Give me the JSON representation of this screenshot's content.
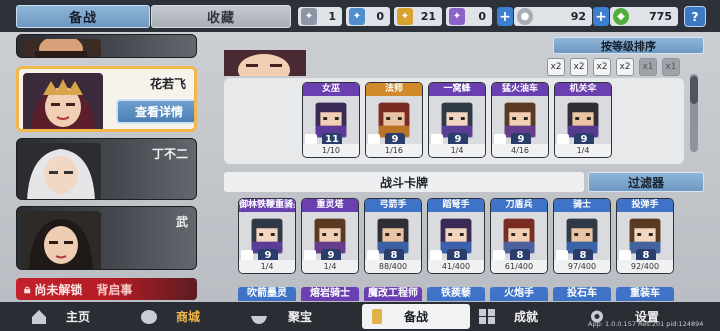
{
  "tabs": {
    "active": "备战",
    "inactive": "收藏"
  },
  "resources": [
    {
      "name": "scroll-blue",
      "value": "1",
      "color": "#8c96a6"
    },
    {
      "name": "scroll-cyan",
      "value": "0",
      "color": "#4f8fce"
    },
    {
      "name": "scroll-gold",
      "value": "21",
      "color": "#d8a22e"
    },
    {
      "name": "scroll-purple",
      "value": "0",
      "color": "#8a62c8"
    },
    {
      "name": "silver-coin",
      "value": "92",
      "color": "#a8adb5"
    },
    {
      "name": "green-gem",
      "value": "775",
      "color": "#4fae3c"
    }
  ],
  "help_label": "?",
  "plus_label": "+",
  "heroes": [
    {
      "name": "花若飞",
      "selected": true,
      "detail_label": "查看详情"
    },
    {
      "name": "丁不二",
      "selected": false
    },
    {
      "name": "武",
      "selected": false
    }
  ],
  "locked_banner": {
    "text": "尚未解锁",
    "suffix": "背启事"
  },
  "sort_label": "按等级排序",
  "filter_icons": [
    {
      "label": "x2",
      "active": true
    },
    {
      "label": "x2",
      "active": true
    },
    {
      "label": "x2",
      "active": true
    },
    {
      "label": "x2",
      "active": true
    },
    {
      "label": "x1",
      "active": false
    },
    {
      "label": "x1",
      "active": false
    }
  ],
  "deck_cards": [
    {
      "name": "女巫",
      "level": "11",
      "count": "1/10",
      "color": "#6a3fb0"
    },
    {
      "name": "法师",
      "level": "9",
      "count": "1/16",
      "color": "#d08a2a"
    },
    {
      "name": "一窝蜂",
      "level": "9",
      "count": "1/4",
      "color": "#6a3fb0"
    },
    {
      "name": "猛火油车",
      "level": "9",
      "count": "4/16",
      "color": "#6a3fb0"
    },
    {
      "name": "机关伞",
      "level": "9",
      "count": "1/4",
      "color": "#6a3fb0"
    }
  ],
  "section_title": "战斗卡牌",
  "filter_button": "过滤器",
  "battle_cards": [
    {
      "name": "御林铁鞭重骑兵",
      "level": "9",
      "count": "1/4",
      "color": "#6a3fb0"
    },
    {
      "name": "重灵塔",
      "level": "9",
      "count": "1/4",
      "color": "#6a3fb0"
    },
    {
      "name": "弓箭手",
      "level": "8",
      "count": "88/400",
      "color": "#3e73c8"
    },
    {
      "name": "蹈弩手",
      "level": "8",
      "count": "41/400",
      "color": "#3e73c8"
    },
    {
      "name": "刀盾兵",
      "level": "8",
      "count": "61/400",
      "color": "#3e73c8"
    },
    {
      "name": "骑士",
      "level": "8",
      "count": "97/400",
      "color": "#3e73c8"
    },
    {
      "name": "投弹手",
      "level": "8",
      "count": "92/400",
      "color": "#3e73c8"
    }
  ],
  "peek_cards": [
    {
      "name": "吹箭墨灵",
      "color": "#3e73c8"
    },
    {
      "name": "熔岩骑士",
      "color": "#6a3fb0"
    },
    {
      "name": "魔改工程师",
      "color": "#6a3fb0"
    },
    {
      "name": "铁蒺藜",
      "color": "#3e73c8"
    },
    {
      "name": "火炮手",
      "color": "#3e73c8"
    },
    {
      "name": "投石车",
      "color": "#3e73c8"
    },
    {
      "name": "重装车",
      "color": "#3e73c8"
    }
  ],
  "nav": [
    {
      "label": "主页",
      "active": false
    },
    {
      "label": "商城",
      "active": false
    },
    {
      "label": "聚宝",
      "active": false
    },
    {
      "label": "备战",
      "active": true
    },
    {
      "label": "成就",
      "active": false
    },
    {
      "label": "设置",
      "active": false
    }
  ],
  "version": "App: 1.0.0.157 Res:201 pid:124894"
}
